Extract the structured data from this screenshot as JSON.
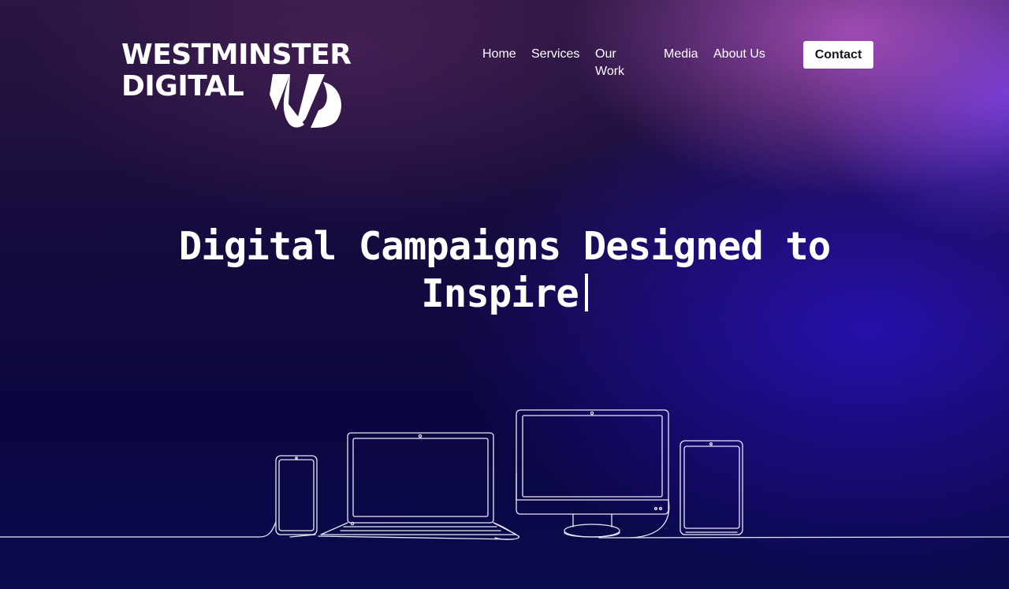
{
  "brand": {
    "line1": "WESTMINSTER",
    "line2": "DIGITAL",
    "mark": "W-icon"
  },
  "nav": {
    "items": [
      "Home",
      "Services",
      "Our Work",
      "Media",
      "About Us"
    ],
    "contact": "Contact"
  },
  "hero": {
    "line1": "Digital Campaigns Designed to",
    "line2": "Inspire"
  },
  "colors": {
    "background_dark": "#0a0637",
    "accent_pink": "#b254c4",
    "accent_violet": "#6838ec",
    "accent_blue": "#2a12be",
    "button_bg": "#ffffff"
  },
  "illustration": {
    "icon": "devices-line-art-icon"
  }
}
